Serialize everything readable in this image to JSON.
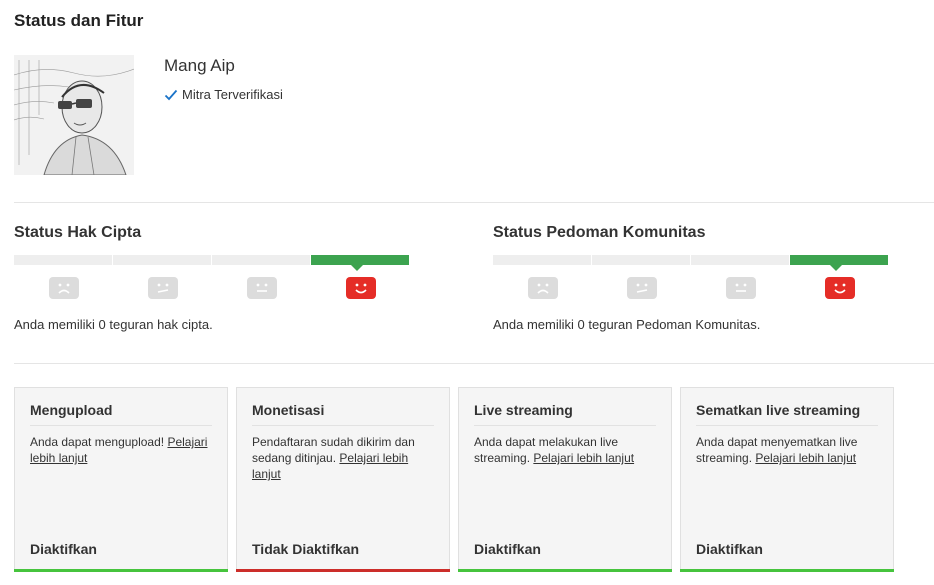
{
  "page": {
    "title": "Status dan Fitur"
  },
  "profile": {
    "name": "Mang Aip",
    "verified_label": "Mitra Terverifikasi"
  },
  "copyright": {
    "title": "Status Hak Cipta",
    "message": "Anda memiliki 0 teguran hak cipta.",
    "strikes": 0
  },
  "community": {
    "title": "Status Pedoman Komunitas",
    "message": "Anda memiliki 0 teguran Pedoman Komunitas.",
    "strikes": 0
  },
  "colors": {
    "enabled": "#46c43d",
    "disabled": "#cc2e2a",
    "status_good": "#3ca34f",
    "face_active": "#e52d27",
    "face_inactive": "#dcdcdc"
  },
  "features": [
    {
      "title": "Mengupload",
      "desc": "Anda dapat mengupload! ",
      "link": "Pelajari lebih lanjut",
      "status": "Diaktifkan"
    },
    {
      "title": "Monetisasi",
      "desc": "Pendaftaran sudah dikirim dan sedang ditinjau. ",
      "link": "Pelajari lebih lanjut",
      "status": "Tidak Diaktifkan"
    },
    {
      "title": "Live streaming",
      "desc": "Anda dapat melakukan live streaming. ",
      "link": "Pelajari lebih lanjut",
      "status": "Diaktifkan"
    },
    {
      "title": "Sematkan live streaming",
      "desc": "Anda dapat menyematkan live streaming. ",
      "link": "Pelajari lebih lanjut",
      "status": "Diaktifkan"
    }
  ]
}
